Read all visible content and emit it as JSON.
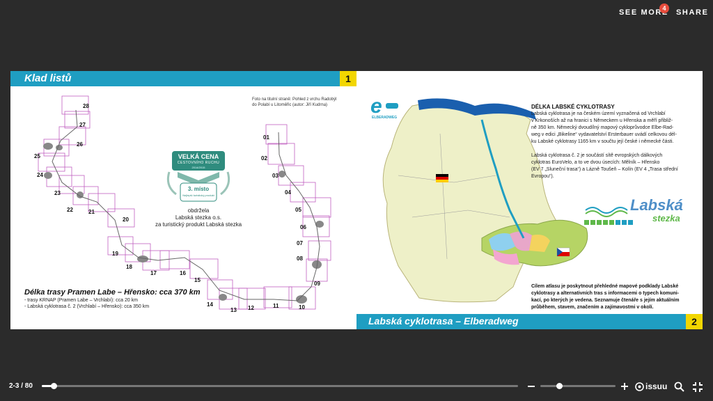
{
  "header": {
    "see_more": "SEE MORE",
    "badge": "4",
    "share": "SHARE"
  },
  "left_page": {
    "title": "Klad listů",
    "page_number": "1",
    "caption_lines": [
      "Foto na titulní straně: Pohled z vrchu Radobýl",
      "do Polabí u Litoměřic (autor: Jiří Kudrna)"
    ],
    "award": {
      "line1": "VELKÁ CENA",
      "line2": "CESTOVNÍHO RUCHU",
      "years": "2014/2015",
      "place": "3. místo",
      "category": "Nejlepší turistický produkt"
    },
    "award_text": [
      "obdržela",
      "Labská stezka o.s.",
      "za turistický produkt Labská stezka"
    ],
    "route_title": "Délka trasy Pramen Labe – Hřensko: cca 370 km",
    "route_lines": [
      "- trasy KRNAP (Pramen Labe – Vrchlabí): cca 20 km",
      "- Labská cyklotrasa č. 2 (Vrchlabí – Hřensko): cca 350 km"
    ],
    "tile_numbers": [
      "01",
      "02",
      "03",
      "04",
      "05",
      "06",
      "07",
      "08",
      "09",
      "10",
      "11",
      "12",
      "13",
      "14",
      "15",
      "16",
      "17",
      "18",
      "19",
      "20",
      "21",
      "22",
      "23",
      "24",
      "25",
      "26",
      "27",
      "28"
    ]
  },
  "right_page": {
    "page_number": "2",
    "footer_title": "Labská cyklotrasa – Elberadweg",
    "logo_text": "ELBERADWEG",
    "labska_line1": "Labská",
    "labska_line2": "stezka",
    "section_title": "DÉLKA LABSKÉ CYKLOTRASY",
    "paragraph1": [
      "Labská cyklotrasa je na českém území vyznačená od Vrchlabí",
      "v Krkonoších až na hranici s Německem u Hřenska a měří přibliž-",
      "ně 350 km. Německý dvoudílný mapový cykloprůvodce Elbe-Rad-",
      "weg v edici „Bikeline“ vydavatelství Ersterbauer uvádí celkovou dél-",
      "ku Labské cyklotrasy 1165 km v součtu její české i německé části."
    ],
    "paragraph2": [
      "Labská cyklotrasa č. 2 je součástí sítě evropských dálkových",
      "cyklotras EuroVelo, a to ve dvou úsecích: Mělník – Hřensko",
      "(EV 7 „Sluneční trasa“) a Lázně Toušeň – Kolín (EV 4 „Trasa střední",
      "Evropou“)."
    ],
    "paragraph3": [
      "Cílem atlasu je poskytnout přehledné mapové podklady Labské",
      "cyklotrasy a alternativních tras s informacemi o typech komuni-",
      "kací, po kterých je vedena. Seznamuje čtenáře s jejím aktuálním",
      "průběhem, stavem, značením a zajímavostmi v okolí."
    ]
  },
  "footer": {
    "page_count": "2-3 / 80",
    "progress": 0.025,
    "zoom_level": 0.25,
    "brand": "issuu"
  },
  "colors": {
    "accent": "#1f9ec2",
    "page_number_bg": "#f2d600",
    "background": "#2b2b2b"
  }
}
